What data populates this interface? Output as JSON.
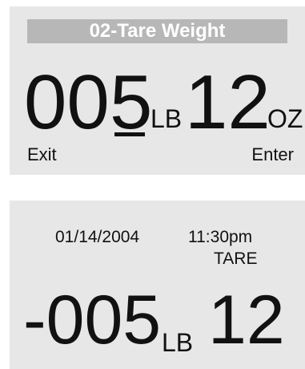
{
  "tare_entry_screen": {
    "title": "02-Tare Weight",
    "digits_before_cursor": "00",
    "cursor_digit": "5",
    "pounds_unit": "LB",
    "ounces": "12",
    "ounces_unit": "OZ",
    "exit_label": "Exit",
    "enter_label": "Enter"
  },
  "home_screen": {
    "date": "01/14/2004",
    "time": "11:30pm",
    "mode": "TARE",
    "pounds": "-005",
    "pounds_unit": "LB",
    "ounces": "12"
  }
}
